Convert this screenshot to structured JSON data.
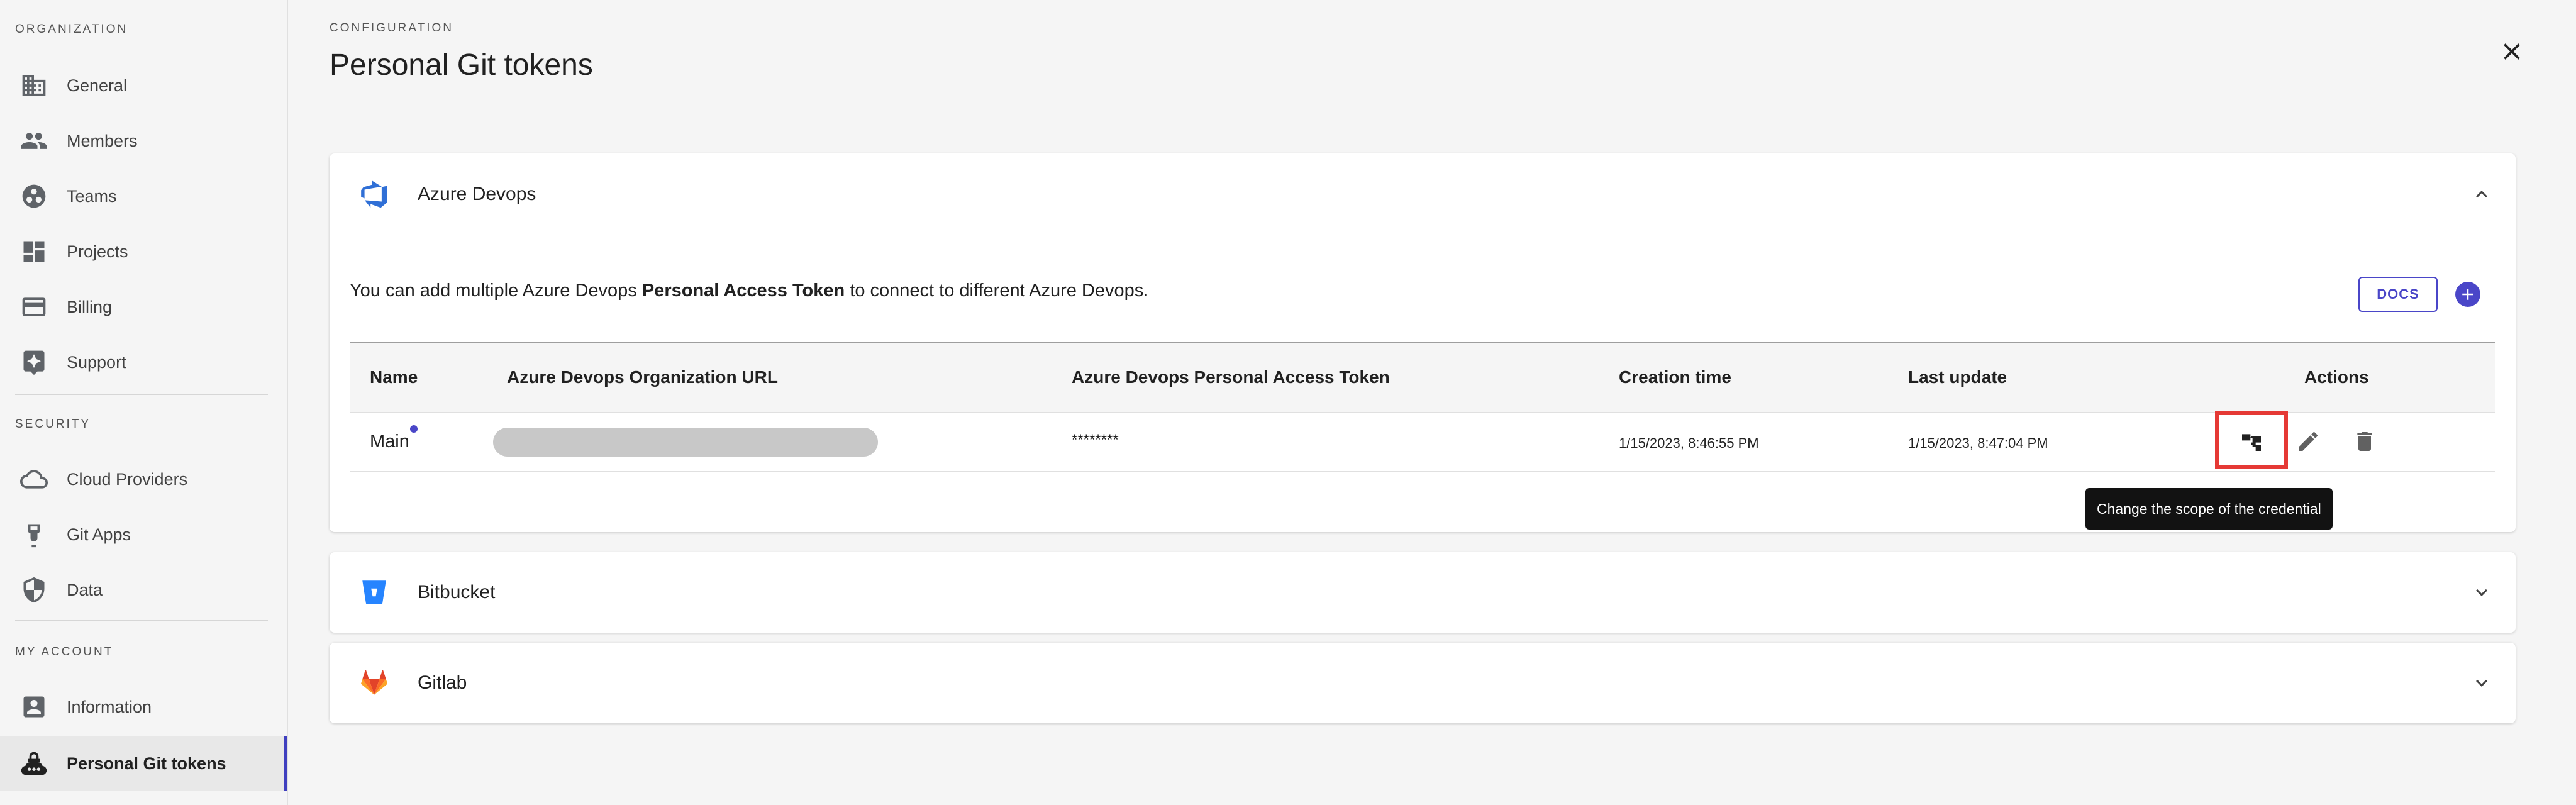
{
  "sidebar": {
    "organization_title": "ORGANIZATION",
    "security_title": "SECURITY",
    "account_title": "MY ACCOUNT",
    "items": [
      {
        "label": "General",
        "icon": "building-icon"
      },
      {
        "label": "Members",
        "icon": "people-icon"
      },
      {
        "label": "Teams",
        "icon": "team-icon"
      },
      {
        "label": "Projects",
        "icon": "dashboard-icon"
      },
      {
        "label": "Billing",
        "icon": "credit-card-icon"
      },
      {
        "label": "Support",
        "icon": "support-icon"
      },
      {
        "label": "Cloud Providers",
        "icon": "cloud-icon"
      },
      {
        "label": "Git Apps",
        "icon": "git-app-icon"
      },
      {
        "label": "Data",
        "icon": "shield-icon"
      },
      {
        "label": "Information",
        "icon": "account-box-icon"
      },
      {
        "label": "Personal Git tokens",
        "icon": "lock-cloud-icon"
      }
    ]
  },
  "header": {
    "overline": "CONFIGURATION",
    "title": "Personal Git tokens"
  },
  "azure": {
    "name": "Azure Devops",
    "desc_prefix": "You can add multiple Azure Devops ",
    "desc_bold": "Personal Access Token",
    "desc_suffix": " to connect to different Azure Devops.",
    "docs_label": "DOCS",
    "columns": [
      "Name",
      "Azure Devops Organization URL",
      "Azure Devops Personal Access Token",
      "Creation time",
      "Last update",
      "Actions"
    ],
    "rows": [
      {
        "name": "Main",
        "token": "********",
        "created": "1/15/2023, 8:46:55 PM",
        "updated": "1/15/2023, 8:47:04 PM"
      }
    ],
    "tooltip": "Change the scope of the credential"
  },
  "bitbucket": {
    "name": "Bitbucket"
  },
  "gitlab": {
    "name": "Gitlab"
  },
  "colors": {
    "accent": "#4a46c8",
    "highlight": "#e53935"
  }
}
